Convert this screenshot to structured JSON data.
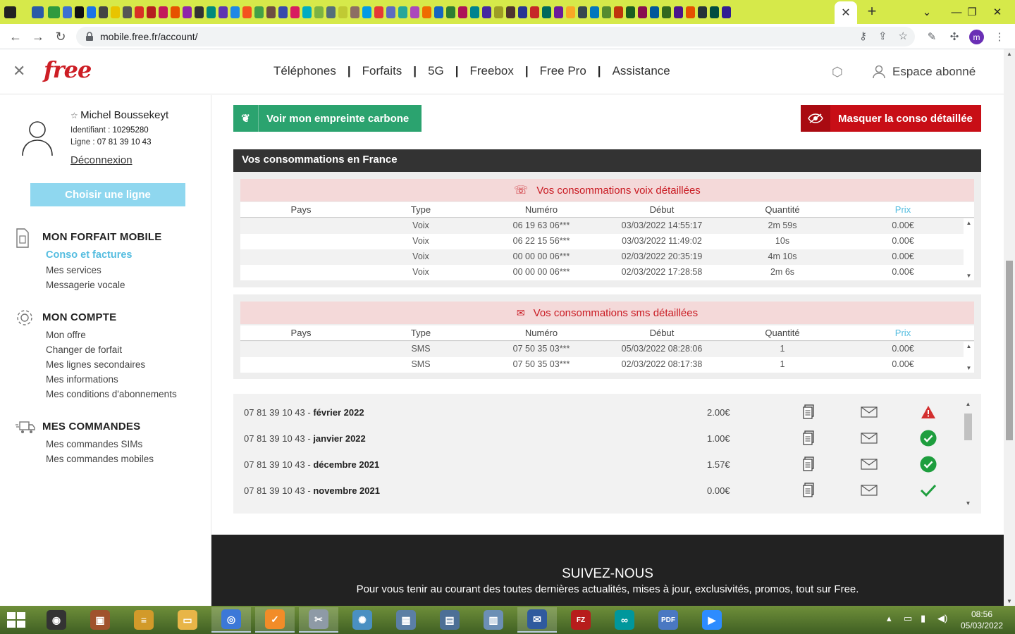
{
  "browser": {
    "tab_close": "✕",
    "new_tab": "+",
    "url": "mobile.free.fr/account/",
    "profile_initial": "m"
  },
  "header": {
    "logo": "free",
    "nav": [
      "Téléphones",
      "Forfaits",
      "5G",
      "Freebox",
      "Free Pro",
      "Assistance"
    ],
    "espace": "Espace abonné"
  },
  "user": {
    "name": "Michel Boussekeyt",
    "id_label": "Identifiant :",
    "id_value": "10295280",
    "line_label": "Ligne :",
    "line_value": "07 81 39 10 43",
    "logout": "Déconnexion"
  },
  "sidebar": {
    "choose_line": "Choisir une ligne",
    "sections": [
      {
        "title": "MON FORFAIT MOBILE",
        "icon": "sim-card-icon",
        "links": [
          "Conso et factures",
          "Mes services",
          "Messagerie vocale"
        ]
      },
      {
        "title": "MON COMPTE",
        "icon": "gear-icon",
        "links": [
          "Mon offre",
          "Changer de forfait",
          "Mes lignes secondaires",
          "Mes informations",
          "Mes conditions d'abonnements"
        ]
      },
      {
        "title": "MES COMMANDES",
        "icon": "delivery-truck-icon",
        "links": [
          "Mes commandes SIMs",
          "Mes commandes mobiles"
        ]
      }
    ]
  },
  "actions": {
    "carbon": "Voir mon empreinte carbone",
    "hide_detail": "Masquer la conso détaillée"
  },
  "conso": {
    "title": "Vos consommations en France",
    "columns": [
      "Pays",
      "Type",
      "Numéro",
      "Début",
      "Quantité",
      "Prix"
    ],
    "voice": {
      "title": "Vos consommations voix détaillées",
      "rows": [
        [
          "",
          "Voix",
          "06 19 63 06***",
          "03/03/2022 14:55:17",
          "2m 59s",
          "0.00€"
        ],
        [
          "",
          "Voix",
          "06 22 15 56***",
          "03/03/2022 11:49:02",
          "10s",
          "0.00€"
        ],
        [
          "",
          "Voix",
          "00 00 00 06***",
          "02/03/2022 20:35:19",
          "4m 10s",
          "0.00€"
        ],
        [
          "",
          "Voix",
          "00 00 00 06***",
          "02/03/2022 17:28:58",
          "2m 6s",
          "0.00€"
        ]
      ]
    },
    "sms": {
      "title": "Vos consommations sms détaillées",
      "rows": [
        [
          "",
          "SMS",
          "07 50 35 03***",
          "05/03/2022 08:28:06",
          "1",
          "0.00€"
        ],
        [
          "",
          "SMS",
          "07 50 35 03***",
          "02/03/2022 08:17:38",
          "1",
          "0.00€"
        ]
      ]
    }
  },
  "invoices": [
    {
      "line": "07 81 39 10 43 - ",
      "month": "février 2022",
      "amount": "2.00€",
      "status": "warning"
    },
    {
      "line": "07 81 39 10 43 - ",
      "month": "janvier 2022",
      "amount": "1.00€",
      "status": "paid"
    },
    {
      "line": "07 81 39 10 43 - ",
      "month": "décembre 2021",
      "amount": "1.57€",
      "status": "paid"
    },
    {
      "line": "07 81 39 10 43 - ",
      "month": "novembre 2021",
      "amount": "0.00€",
      "status": "ok"
    }
  ],
  "footer": {
    "title": "SUIVEZ-NOUS",
    "subtitle": "Pour vous tenir au courant des toutes dernières actualités, mises à jour, exclusivités, promos, tout sur Free."
  },
  "taskbar": {
    "time": "08:56",
    "date": "05/03/2022"
  },
  "colors": {
    "brand_red": "#cd1e25",
    "green_button": "#2ba36f",
    "red_button": "#c80e16",
    "accent_blue": "#55bde0"
  }
}
